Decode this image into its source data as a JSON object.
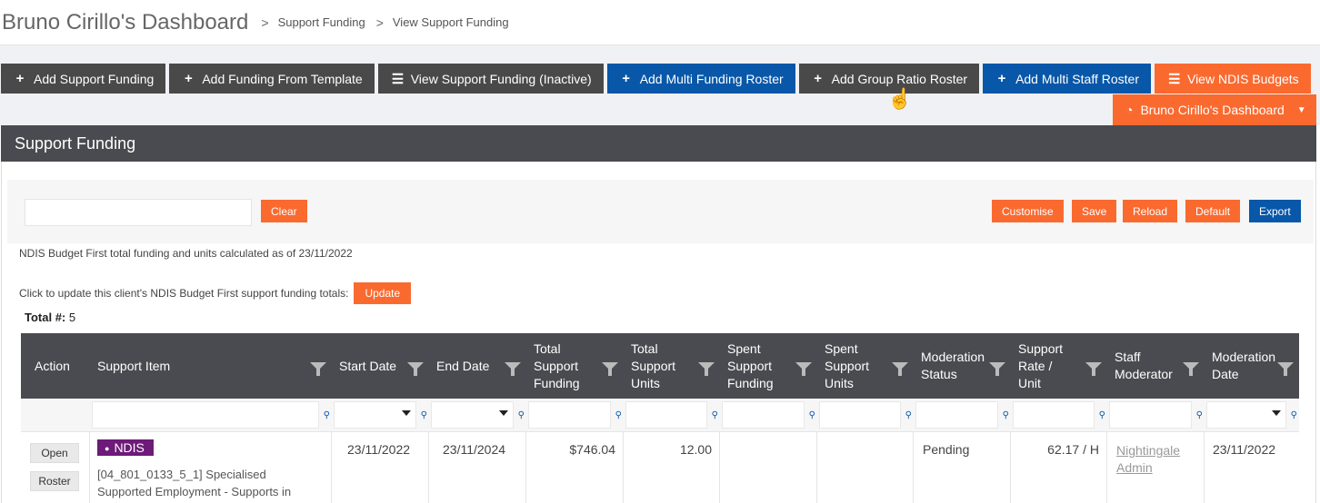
{
  "header": {
    "title": "Bruno Cirillo's Dashboard",
    "separator": ">",
    "breadcrumbs": [
      "Support Funding",
      "View Support Funding"
    ]
  },
  "toolbar": {
    "buttons": [
      {
        "label": "Add Support Funding",
        "icon": "plus-icon",
        "style": "dark"
      },
      {
        "label": "Add Funding From Template",
        "icon": "plus-icon",
        "style": "dark"
      },
      {
        "label": "View Support Funding (Inactive)",
        "icon": "list-icon",
        "style": "dark"
      },
      {
        "label": "Add Multi Funding Roster",
        "icon": "plus-icon",
        "style": "blue"
      },
      {
        "label": "Add Group Ratio Roster",
        "icon": "plus-icon",
        "style": "dark"
      },
      {
        "label": "Add Multi Staff Roster",
        "icon": "plus-icon",
        "style": "blue"
      },
      {
        "label": "View NDIS Budgets",
        "icon": "list-icon",
        "style": "orange"
      }
    ],
    "dashboard_button": {
      "label": "Bruno Cirillo's Dashboard",
      "icon": "dashboard-icon"
    }
  },
  "panel": {
    "title": "Support Funding",
    "search": {
      "value": "",
      "placeholder": ""
    },
    "clear_label": "Clear",
    "actions": [
      "Customise",
      "Save",
      "Reload",
      "Default",
      "Export"
    ],
    "info_text": "NDIS Budget First total funding and units calculated as of 23/11/2022",
    "update_text": "Click to update this client's NDIS Budget First support funding totals:",
    "update_label": "Update",
    "total_label": "Total #:",
    "total_value": "5"
  },
  "grid": {
    "columns": [
      "Action",
      "Support Item",
      "Start Date",
      "End Date",
      "Total Support Funding",
      "Total Support Units",
      "Spent Support Funding",
      "Spent Support Units",
      "Moderation Status",
      "Support Rate / Unit",
      "Staff Moderator",
      "Moderation Date"
    ],
    "rows": [
      {
        "open_label": "Open",
        "roster_label": "Roster",
        "badge": "NDIS",
        "support_item": "[04_801_0133_5_1] Specialised Supported Employment - Supports in",
        "start_date": "23/11/2022",
        "end_date": "23/11/2024",
        "total_funding": "$746.04",
        "total_units": "12.00",
        "spent_funding": "",
        "spent_units": "",
        "moderation_status": "Pending",
        "rate": "62.17 / H",
        "staff_moderator": "Nightingale Admin",
        "moderation_date": "23/11/2022"
      }
    ]
  },
  "colors": {
    "dark": "#494949",
    "blue": "#0857a9",
    "orange": "#fa6a2f",
    "badge": "#6d1a78",
    "panel_header": "#494b50"
  }
}
